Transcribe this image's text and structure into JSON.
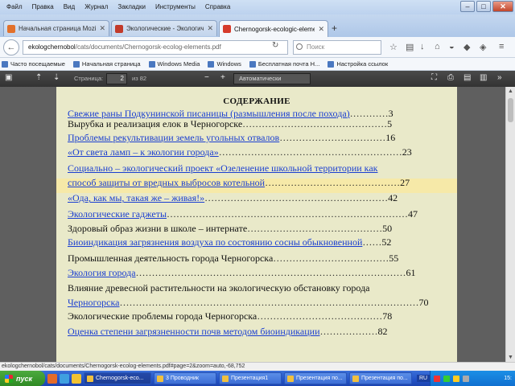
{
  "menubar": {
    "items": [
      "Файл",
      "Правка",
      "Вид",
      "Журнал",
      "Закладки",
      "Инструменты",
      "Справка"
    ]
  },
  "tabs": [
    {
      "label": "Начальная страница Mozilla",
      "icon": "firefox-icon",
      "color": "#e2702a"
    },
    {
      "label": "Экологические - Экологические",
      "icon": "page-icon",
      "color": "#c23a2a"
    },
    {
      "label": "Chernogorsk-ecologic-elements",
      "icon": "pdf-icon",
      "color": "#d63b2b"
    }
  ],
  "navbar": {
    "url_prefix": "ekologchernobol",
    "url_rest": "/cats/documents/Chernogorsk-ecolog-elements.pdf",
    "search_placeholder": "Поиск"
  },
  "bookmarks": [
    "Часто посещаемые",
    "Начальная страница",
    "Windows Media",
    "Windows",
    "Бесплатная почта H...",
    "Настройка ссылок"
  ],
  "pdf_toolbar": {
    "page_label": "Страница:",
    "page_value": "2",
    "page_count": "из 82",
    "zoom": "Автоматически"
  },
  "document": {
    "title": "СОДЕРЖАНИЕ",
    "entries": [
      {
        "text": "Свежие раны Подкунинской писаницы (размышления после похода)",
        "dots": "…………",
        "page": "3",
        "link": true
      },
      {
        "text": "Вырубка и реализация елок в Черногорске",
        "dots": "………………………………………",
        "page": "5",
        "link": false
      },
      {
        "text": "Проблемы рекультивации земель угольных отвалов",
        "dots": "……………………………",
        "page": "16",
        "link": true
      },
      {
        "text": "«От света ламп – к экологии города»",
        "dots": "…………………………………………………",
        "page": "23",
        "link": true
      },
      {
        "text": "Социально – экологический проект «Озеленение школьной территории как",
        "dots": "",
        "page": "",
        "link": true
      },
      {
        "text": "способ защиты от вредных выбросов котельной",
        "dots": "……………………………………",
        "page": "27",
        "link": true
      },
      {
        "text": "«Ода, как мы, такая же – живая!»",
        "dots": "…………………………………………………",
        "page": "42",
        "link": true
      },
      {
        "text": "Экологические гаджеты",
        "dots": "…………………………………………………………………",
        "page": "47",
        "link": true
      },
      {
        "text": "Здоровый образ жизни в школе – интернате",
        "dots": "……………………………………",
        "page": "50",
        "link": false
      },
      {
        "text": "Биоиндикация загрязнения воздуха по состоянию сосны обыкновенной",
        "dots": "……",
        "page": "52",
        "link": true
      },
      {
        "text": "Промышленная деятельность города Черногорска",
        "dots": "………………………………",
        "page": "55",
        "link": false
      },
      {
        "text": "Экология города",
        "dots": "…………………………………………………………………………",
        "page": "61",
        "link": true
      },
      {
        "text": "Влияние древесной растительности на экологическую обстановку города",
        "dots": "",
        "page": "",
        "link": false
      },
      {
        "text": "Черногорска",
        "dots": "…………………………………………………………………………………",
        "page": "70",
        "link": true
      },
      {
        "text": "Экологические проблемы города Черногорска",
        "dots": "…………………………………",
        "page": "78",
        "link": false
      },
      {
        "text": "Оценка степени загрязненности почв методом биоиндикации",
        "dots": "………………",
        "page": "82",
        "link": true
      }
    ]
  },
  "statusbar": {
    "text": "ekologchernobol/cats/documents/Chernogorsk-ecolog-elements.pdf#page=2&zoom=auto,-68,752"
  },
  "taskbar": {
    "start_label": "пуск",
    "buttons": [
      {
        "label": "Chernogorsk-eco...",
        "active": true
      },
      {
        "label": "3 Проводник",
        "active": false
      },
      {
        "label": "Презентация1",
        "active": false
      },
      {
        "label": "Презентация по...",
        "active": false
      },
      {
        "label": "Презентация по...",
        "active": false
      }
    ],
    "lang": "RU",
    "clock": "15:"
  }
}
